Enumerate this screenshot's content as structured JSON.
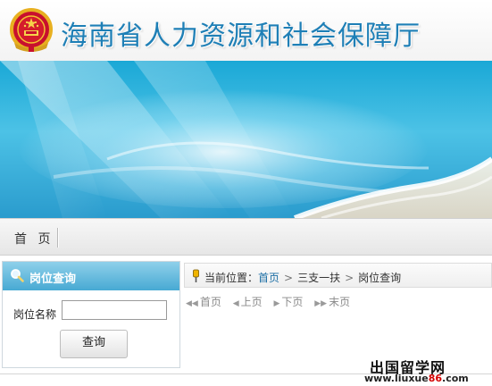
{
  "header": {
    "site_title": "海南省人力资源和社会保障厅"
  },
  "nav": {
    "items": [
      {
        "label": "首 页"
      }
    ]
  },
  "left_panel": {
    "title": "岗位查询",
    "field_label": "岗位名称",
    "field_value": "",
    "query_button": "查询"
  },
  "breadcrumb": {
    "prefix": "当前位置：",
    "items": [
      "首页",
      "三支一扶",
      "岗位查询"
    ],
    "separator": ">"
  },
  "pager": {
    "first": "首页",
    "prev": "上页",
    "next": "下页",
    "last": "末页"
  },
  "watermark": {
    "text": "出国留学网",
    "url_pre": "www.liuxue",
    "url_num": "86",
    "url_post": ".com"
  },
  "colors": {
    "title": "#1e7fb6",
    "panel_header": "#47a9d3",
    "link": "#1d6fa5"
  },
  "icons": [
    "national-emblem-icon",
    "search-icon",
    "location-pin-icon",
    "first-page-icon",
    "prev-page-icon",
    "next-page-icon",
    "last-page-icon"
  ]
}
